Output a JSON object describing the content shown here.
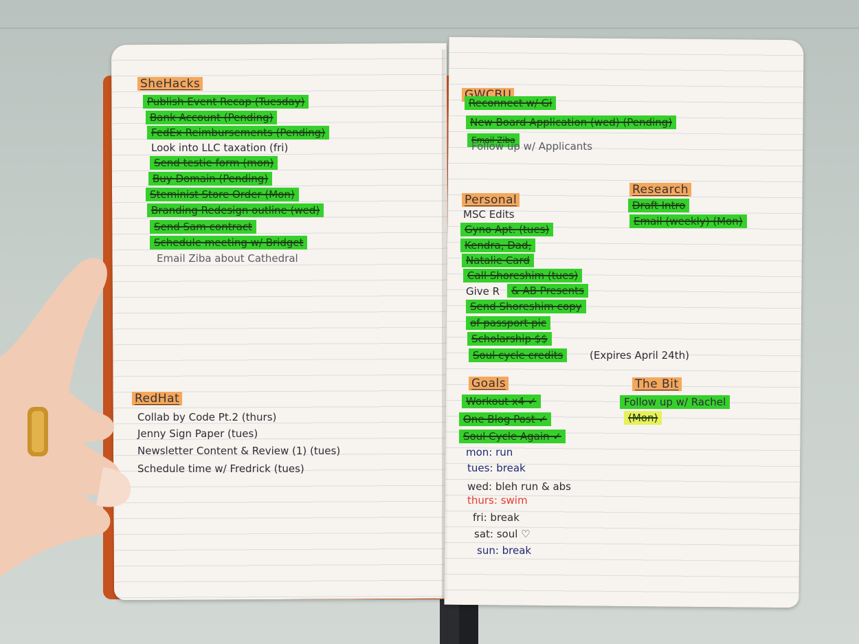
{
  "left_page": {
    "shehacks": {
      "title": "SheHacks",
      "items": [
        "Publish Event Recap (Tuesday)",
        "Bank Account (Pending)",
        "FedEx Reimbursements (Pending)",
        "Look into LLC taxation (fri)",
        "Send testie form (mon)",
        "Buy Domain (Pending)",
        "Steminist Store Order (Mon)",
        "Branding Redesign outline (wed)",
        "Send Sam contract",
        "Schedule meeting w/ Bridget",
        "Email Ziba about Cathedral"
      ]
    },
    "redhat": {
      "title": "RedHat",
      "items": [
        "Collab by Code Pt.2 (thurs)",
        "Jenny Sign Paper (tues)",
        "Newsletter Content & Review (1) (tues)",
        "Schedule time w/ Fredrick (tues)"
      ]
    }
  },
  "right_page": {
    "gwcbu": {
      "title": "GWCBU",
      "items": [
        "Reconnect w/ Gi",
        "New Board Application (wed) (Pending)",
        "Email Ziba",
        "Follow up w/ Applicants"
      ]
    },
    "personal": {
      "title": "Personal",
      "items": [
        "MSC Edits",
        "Gyno Apt. (tues)",
        "Kendra, Dad,",
        "Natalie Card",
        "Call Shoreshim (tues)",
        "Give R",
        "& AB Presents",
        "Send Shoreshim copy",
        "of passport pic",
        "Scholarship $$",
        "Soul cycle credits",
        "(Expires April 24th)"
      ]
    },
    "research": {
      "title": "Research",
      "items": [
        "Draft Intro",
        "Email (weekly) (Mon)"
      ]
    },
    "goals": {
      "title": "Goals",
      "items": [
        "Workout x4 ✓",
        "One Blog Post ✓",
        "Soul Cycle Again ✓",
        "mon: run",
        "tues: break",
        "wed: bleh run & abs",
        "thurs: swim",
        "fri: break",
        "sat: soul ♡",
        "sun: break"
      ]
    },
    "thebit": {
      "title": "The Bit",
      "items": [
        "Follow up w/ Rachel",
        "(Mon)"
      ]
    }
  },
  "colors": {
    "highlight_green": "#36d02c",
    "highlight_orange": "#f4a85b",
    "highlight_yellow": "#e8f05a",
    "notebook_cover": "#e86a2c",
    "ink_navy": "#1d2a78",
    "ink_red": "#e33b32"
  }
}
